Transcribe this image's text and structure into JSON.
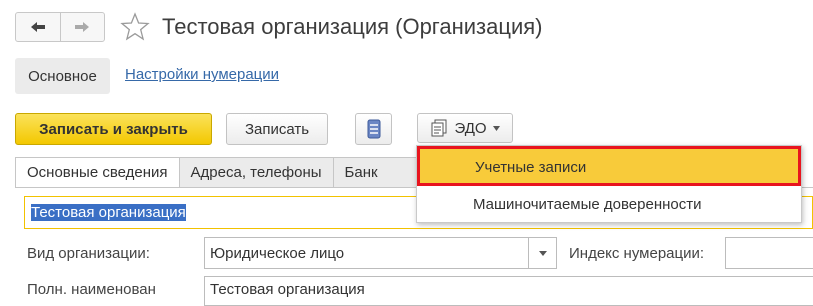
{
  "window": {
    "title": "Тестовая организация (Организация)"
  },
  "nav": {
    "back_icon": "arrow-left-icon",
    "forward_icon": "arrow-right-icon",
    "favorite_icon": "star-icon"
  },
  "sections": {
    "main": "Основное",
    "numbering_settings": "Настройки нумерации"
  },
  "toolbar": {
    "save_close": "Записать и закрыть",
    "save": "Записать",
    "list_icon": "list-icon",
    "edo": "ЭДО",
    "edo_icon": "document-stack-icon"
  },
  "edo_menu": {
    "items": [
      "Учетные записи",
      "Машиночитаемые доверенности"
    ]
  },
  "tabs": [
    "Основные сведения",
    "Адреса, телефоны",
    "Банк"
  ],
  "form": {
    "name_value": "Тестовая организация",
    "org_type_label": "Вид организации:",
    "org_type_value": "Юридическое лицо",
    "index_label": "Индекс нумерации:",
    "index_value": "",
    "full_name_label": "Полн. наименован",
    "full_name_value": "Тестовая организация"
  },
  "colors": {
    "primary_button": "#f3c800",
    "highlight_item": "#f8cb3a",
    "highlight_border": "#e8141e",
    "selection": "#3a6fc5",
    "link": "#3669a8"
  }
}
